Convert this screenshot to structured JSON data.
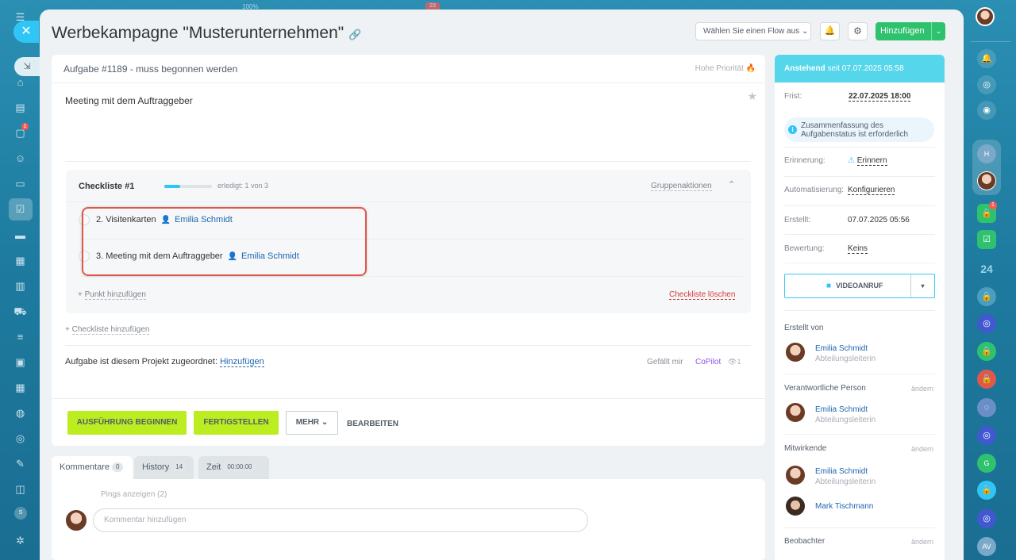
{
  "sidebar_left": {
    "icons": [
      "menu-icon",
      "home-icon",
      "feed-icon",
      "chat-icon",
      "contacts-icon",
      "docs-icon",
      "tasks-icon",
      "crm-icon",
      "sites-icon",
      "analytics-icon",
      "shop-icon",
      "warehouse-icon",
      "inventory-icon",
      "calendar-icon",
      "robot-icon",
      "marketing-icon",
      "forms-icon",
      "hr-icon",
      "more-icon",
      "settings-icon"
    ],
    "chat_badge": "1",
    "s_label": "S"
  },
  "top_hint": {
    "zoom": "100%",
    "badge": "23"
  },
  "page": {
    "title": "Werbekampagne \"Musterunternehmen\"",
    "flow_select": "Wählen Sie einen Flow aus",
    "add_button": "Hinzufügen"
  },
  "task": {
    "header": "Aufgabe #1189 - muss begonnen werden",
    "priority": "Hohe Priorität",
    "description": "Meeting mit dem Auftraggeber",
    "checklist": {
      "title": "Checkliste #1",
      "progress": 0.333,
      "done_text": "erledigt: 1 von 3",
      "group_actions": "Gruppenaktionen",
      "items": [
        {
          "text": "2. Visitenkarten",
          "user": "Emilia Schmidt"
        },
        {
          "text": "3. Meeting mit dem Auftraggeber",
          "user": "Emilia Schmidt"
        }
      ],
      "add_point": "Punkt hinzufügen",
      "delete": "Checkliste löschen"
    },
    "add_checklist": "Checkliste hinzufügen",
    "project_label": "Aufgabe ist diesem Projekt zugeordnet:",
    "project_link": "Hinzufügen",
    "like": "Gefällt mir",
    "copilot": "CoPilot",
    "views": "1",
    "buttons": {
      "start": "AUSFÜHRUNG BEGINNEN",
      "finish": "FERTIGSTELLEN",
      "more": "MEHR",
      "edit": "BEARBEITEN"
    }
  },
  "tabs": [
    {
      "label": "Kommentare",
      "count": "0"
    },
    {
      "label": "History",
      "count": "14"
    },
    {
      "label": "Zeit",
      "count": "00:00:00"
    }
  ],
  "comments": {
    "pings": "Pings anzeigen (2)",
    "placeholder": "Kommentar hinzufügen"
  },
  "side": {
    "status": "Anstehend",
    "status_since": "seit 07.07.2025 05:58",
    "deadline_label": "Frist:",
    "deadline": "22.07.2025 18:00",
    "info": "Zusammenfassung des Aufgabenstatus ist erforderlich",
    "reminder_label": "Erinnerung:",
    "reminder": "Erinnern",
    "automation_label": "Automatisierung:",
    "automation": "Konfigurieren",
    "created_label": "Erstellt:",
    "created": "07.07.2025 05:56",
    "rating_label": "Bewertung:",
    "rating": "Keins",
    "video": "VIDEOANRUF",
    "created_by": "Erstellt von",
    "responsible": "Verantwortliche Person",
    "participants": "Mitwirkende",
    "observers": "Beobachter",
    "change": "ändern",
    "user_name": "Emilia Schmidt",
    "user_role": "Abteilungsleiterin",
    "user2_name": "Mark Tischmann"
  },
  "sidebar_right": {
    "badge": "1",
    "number": "24",
    "letters": [
      "H",
      "G",
      "AV"
    ]
  },
  "colors": {
    "accent": "#2fc6f6",
    "green": "#bbed21",
    "link": "#2067b0",
    "red": "#e0584a"
  }
}
